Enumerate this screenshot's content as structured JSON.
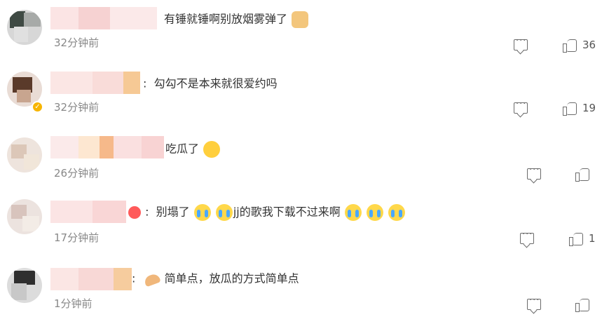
{
  "comments": [
    {
      "text_prefix": "",
      "text": "有锤就锤啊别放烟雾弹了",
      "time": "32分钟前",
      "likes": "36",
      "verified": false
    },
    {
      "text_prefix": ":",
      "text": "勾勾不是本来就很爱约吗",
      "time": "32分钟前",
      "likes": "19",
      "verified": true
    },
    {
      "text_prefix": "",
      "text": "吃瓜了",
      "time": "26分钟前",
      "likes": "",
      "verified": false
    },
    {
      "text_prefix": ":",
      "text_a": "别塌了",
      "text_b": "jj的歌我下载不过来啊",
      "time": "17分钟前",
      "likes": "1",
      "verified": false
    },
    {
      "text_prefix": ":",
      "text": "简单点，放瓜的方式简单点",
      "time": "1分钟前",
      "likes": "",
      "verified": false
    }
  ],
  "icons": {
    "reply": "comment-icon",
    "like": "thumbs-up-icon"
  },
  "colors": {
    "text": "#333333",
    "time": "#888888",
    "verified_badge": "#f7b500"
  }
}
